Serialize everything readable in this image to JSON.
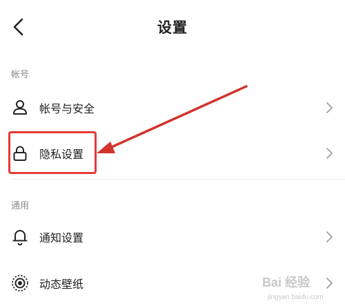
{
  "header": {
    "title": "设置"
  },
  "sections": [
    {
      "label": "帐号"
    },
    {
      "label": "通用"
    }
  ],
  "rows": {
    "account_security": {
      "label": "帐号与安全",
      "icon": "user-icon"
    },
    "privacy": {
      "label": "隐私设置",
      "icon": "lock-icon"
    },
    "notification": {
      "label": "通知设置",
      "icon": "bell-icon"
    },
    "live_wallpaper": {
      "label": "动态壁纸",
      "icon": "wallpaper-icon"
    }
  },
  "annotation": {
    "color": "#e53935"
  },
  "watermark": {
    "main": "Bai 经验",
    "sub": "jingyan.baidu.com"
  }
}
